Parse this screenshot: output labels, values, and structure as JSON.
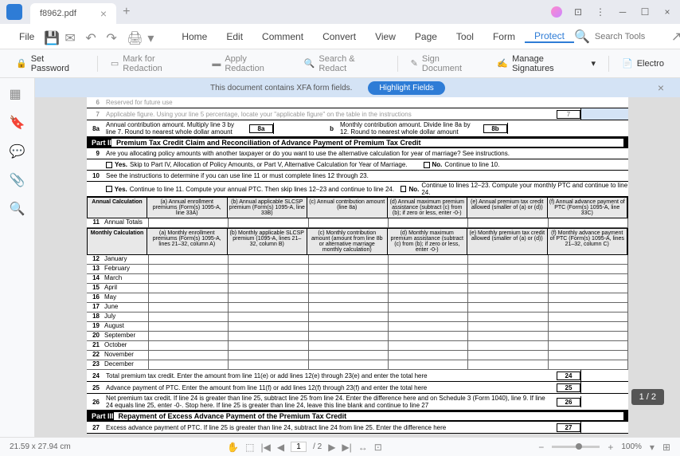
{
  "titlebar": {
    "filename": "f8962.pdf"
  },
  "menu": {
    "file": "File",
    "items": [
      "Home",
      "Edit",
      "Comment",
      "Convert",
      "View",
      "Page",
      "Tool",
      "Form",
      "Protect"
    ],
    "search_placeholder": "Search Tools"
  },
  "toolbar": {
    "set_password": "Set Password",
    "mark_redaction": "Mark for Redaction",
    "apply_redaction": "Apply Redaction",
    "search_redact": "Search & Redact",
    "sign_document": "Sign Document",
    "manage_signatures": "Manage Signatures",
    "electro": "Electro"
  },
  "xfa": {
    "message": "This document contains XFA form fields.",
    "highlight": "Highlight Fields"
  },
  "form": {
    "line6": "6",
    "line6_text": "Reserved for future use",
    "line7": "7",
    "line7_text": "Applicable figure. Using your line 5 percentage, locate your \"applicable figure\" on the table in the instructions",
    "line7_box": "7",
    "line8a": "8a",
    "line8a_text": "Annual contribution amount. Multiply line 3 by line 7. Round to nearest whole dollar amount",
    "line8a_box": "8a",
    "line8b": "b",
    "line8b_text": "Monthly contribution amount. Divide line 8a by 12. Round to nearest whole dollar amount",
    "line8b_box": "8b",
    "part2": "Part II",
    "part2_title": "Premium Tax Credit Claim and Reconciliation of Advance Payment of Premium Tax Credit",
    "line9": "9",
    "line9_text": "Are you allocating policy amounts with another taxpayer or do you want to use the alternative calculation for year of marriage? See instructions.",
    "line9_yes": "Yes.",
    "line9_yes_text": "Skip to Part IV, Allocation of Policy Amounts, or Part V, Alternative Calculation for Year of Marriage.",
    "line9_no": "No.",
    "line9_no_text": "Continue to line 10.",
    "line10": "10",
    "line10_text": "See the instructions to determine if you can use line 11 or must complete lines 12 through 23.",
    "line10_yes": "Yes.",
    "line10_yes_text": "Continue to line 11. Compute your annual PTC. Then skip lines 12–23 and continue to line 24.",
    "line10_no": "No.",
    "line10_no_text": "Continue to lines 12–23. Compute your monthly PTC and continue to line 24.",
    "annual_calc": "Annual Calculation",
    "monthly_calc": "Monthly Calculation",
    "col_a_annual": "(a) Annual enrollment premiums (Form(s) 1095-A, line 33A)",
    "col_b_annual": "(b) Annual applicable SLCSP premium (Form(s) 1095-A, line 33B)",
    "col_c_annual": "(c) Annual contribution amount (line 8a)",
    "col_d_annual": "(d) Annual maximum premium assistance (subtract (c) from (b); if zero or less, enter -0-)",
    "col_e_annual": "(e) Annual premium tax credit allowed (smaller of (a) or (d))",
    "col_f_annual": "(f) Annual advance payment of PTC (Form(s) 1095-A, line 33C)",
    "col_a_monthly": "(a) Monthly enrollment premiums (Form(s) 1095-A, lines 21–32, column A)",
    "col_b_monthly": "(b) Monthly applicable SLCSP premium (1095-A, lines 21–32, column B)",
    "col_c_monthly": "(c) Monthly contribution amount (amount from line 8b or alternative marriage monthly calculation)",
    "col_d_monthly": "(d) Monthly maximum premium assistance (subtract (c) from (b); if zero or less, enter -0-)",
    "col_e_monthly": "(e) Monthly premium tax credit allowed (smaller of (a) or (d))",
    "col_f_monthly": "(f) Monthly advance payment of PTC (Form(s) 1095-A, lines 21–32, column C)",
    "line11": "11",
    "line11_text": "Annual Totals",
    "months": [
      {
        "num": "12",
        "name": "January"
      },
      {
        "num": "13",
        "name": "February"
      },
      {
        "num": "14",
        "name": "March"
      },
      {
        "num": "15",
        "name": "April"
      },
      {
        "num": "16",
        "name": "May"
      },
      {
        "num": "17",
        "name": "June"
      },
      {
        "num": "18",
        "name": "July"
      },
      {
        "num": "19",
        "name": "August"
      },
      {
        "num": "20",
        "name": "September"
      },
      {
        "num": "21",
        "name": "October"
      },
      {
        "num": "22",
        "name": "November"
      },
      {
        "num": "23",
        "name": "December"
      }
    ],
    "line24": "24",
    "line24_text": "Total premium tax credit. Enter the amount from line 11(e) or add lines 12(e) through 23(e) and enter the total here",
    "line24_box": "24",
    "line25": "25",
    "line25_text": "Advance payment of PTC. Enter the amount from line 11(f) or add lines 12(f) through 23(f) and enter the total here",
    "line25_box": "25",
    "line26": "26",
    "line26_text": "Net premium tax credit. If line 24 is greater than line 25, subtract line 25 from line 24. Enter the difference here and on Schedule 3 (Form 1040), line 9. If line 24 equals line 25, enter -0-. Stop here. If line 25 is greater than line 24, leave this line blank and continue to line 27",
    "line26_box": "26",
    "part3": "Part III",
    "part3_title": "Repayment of Excess Advance Payment of the Premium Tax Credit",
    "line27": "27",
    "line27_text": "Excess advance payment of PTC. If line 25 is greater than line 24, subtract line 24 from line 25. Enter the difference here",
    "line27_box": "27"
  },
  "page_indicator": "1 / 2",
  "statusbar": {
    "dimensions": "21.59 x 27.94 cm",
    "page": "1",
    "total": "/ 2",
    "zoom": "100%"
  }
}
